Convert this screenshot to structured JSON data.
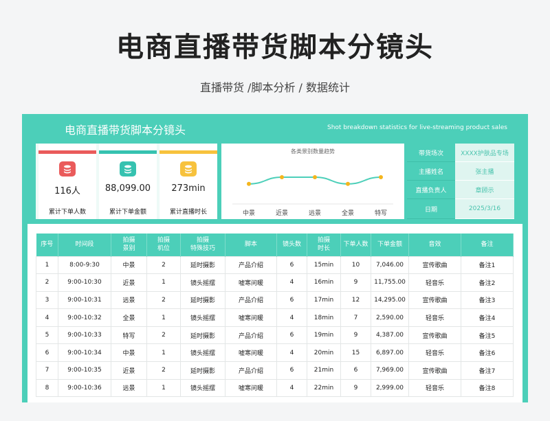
{
  "title": "电商直播带货脚本分镜头",
  "subtitle": "直播带货  /脚本分析 / 数据统计",
  "sheet": {
    "title": "电商直播带货脚本分镜头",
    "subtitle_en": "Shot breakdown statistics for live-streaming product sales"
  },
  "kpis": [
    {
      "value": "116人",
      "label": "累计下单人数",
      "color": "#ea5b5b",
      "icon": "stack-icon"
    },
    {
      "value": "88,099.00",
      "label": "累计下单金额",
      "color": "#36c2b0",
      "icon": "stack-icon"
    },
    {
      "value": "273min",
      "label": "累计直播时长",
      "color": "#f7c23d",
      "icon": "stack-icon"
    }
  ],
  "chart_data": {
    "type": "line",
    "title": "各类景别数量趋势",
    "categories": [
      "中景",
      "近景",
      "远景",
      "全景",
      "特写"
    ],
    "series": [
      {
        "values": [
          3,
          4,
          4,
          3,
          4
        ]
      }
    ],
    "ylim": [
      0,
      8
    ],
    "grid": false,
    "line_color": "#4ccfb9",
    "marker_color": "#f4b51d"
  },
  "info": [
    {
      "key": "带货场次",
      "value": "XXXX护肤品专场"
    },
    {
      "key": "主播姓名",
      "value": "张主播"
    },
    {
      "key": "直播负责人",
      "value": "章顾示"
    },
    {
      "key": "日期",
      "value": "2025/3/16"
    }
  ],
  "table": {
    "headers": [
      [
        "序号"
      ],
      [
        "时间段"
      ],
      [
        "拍摄",
        "景别"
      ],
      [
        "拍摄",
        "机位"
      ],
      [
        "拍摄",
        "特殊技巧"
      ],
      [
        "脚本"
      ],
      [
        "镜头数"
      ],
      [
        "拍摄",
        "时长"
      ],
      [
        "下单人数"
      ],
      [
        "下单金额"
      ],
      [
        "音效"
      ],
      [
        "备注"
      ]
    ],
    "rows": [
      [
        "1",
        "8:00-9:30",
        "中景",
        "2",
        "延时摄影",
        "产品介绍",
        "6",
        "15min",
        "10",
        "7,046.00",
        "宣传歌曲",
        "备注1"
      ],
      [
        "2",
        "9:00-10:30",
        "近景",
        "1",
        "镜头摇摆",
        "嘘寒问暖",
        "4",
        "16min",
        "9",
        "11,755.00",
        "轻音乐",
        "备注2"
      ],
      [
        "3",
        "9:00-10:31",
        "远景",
        "2",
        "延时摄影",
        "产品介绍",
        "6",
        "17min",
        "12",
        "14,295.00",
        "宣传歌曲",
        "备注3"
      ],
      [
        "4",
        "9:00-10:32",
        "全景",
        "1",
        "镜头摇摆",
        "嘘寒问暖",
        "4",
        "18min",
        "7",
        "2,590.00",
        "轻音乐",
        "备注4"
      ],
      [
        "5",
        "9:00-10:33",
        "特写",
        "2",
        "延时摄影",
        "产品介绍",
        "6",
        "19min",
        "9",
        "4,387.00",
        "宣传歌曲",
        "备注5"
      ],
      [
        "6",
        "9:00-10:34",
        "中景",
        "1",
        "镜头摇摆",
        "嘘寒问暖",
        "4",
        "20min",
        "15",
        "6,897.00",
        "轻音乐",
        "备注6"
      ],
      [
        "7",
        "9:00-10:35",
        "近景",
        "2",
        "延时摄影",
        "产品介绍",
        "6",
        "21min",
        "6",
        "7,969.00",
        "宣传歌曲",
        "备注7"
      ],
      [
        "8",
        "9:00-10:36",
        "远景",
        "1",
        "镜头摇摆",
        "嘘寒问暖",
        "4",
        "22min",
        "9",
        "2,999.00",
        "轻音乐",
        "备注8"
      ]
    ]
  }
}
